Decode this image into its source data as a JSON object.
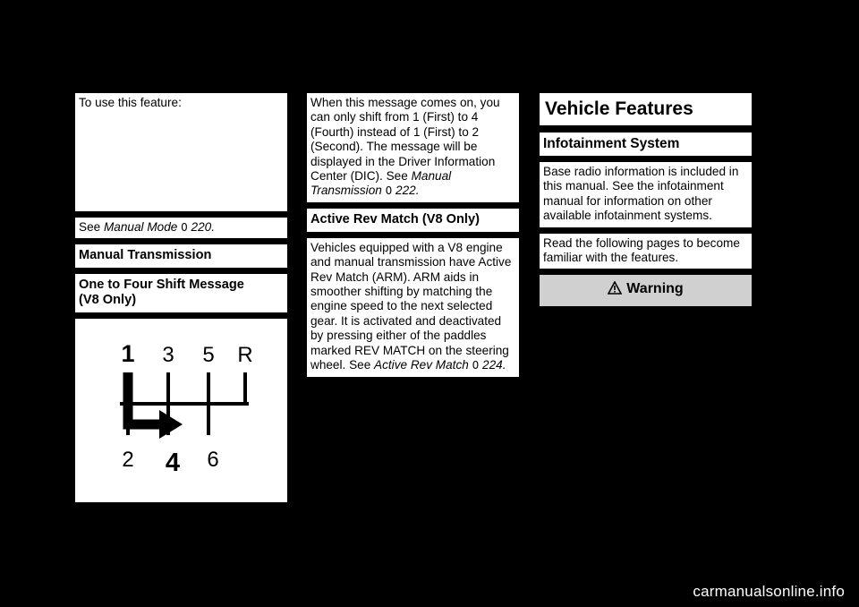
{
  "page": {
    "background_color": "#000000",
    "text_block_color": "#ffffff",
    "gray_box_color": "#d0d0d0"
  },
  "column1": {
    "intro_text": "To use this feature:",
    "see_manual_mode": {
      "lead": "See ",
      "italic": "Manual Mode",
      "marker": "0",
      "page": " 220."
    },
    "heading_manual_transmission": "Manual Transmission",
    "heading_one_to_four": "One to Four Shift Message\n(V8 Only)",
    "shift_pattern": {
      "name": "six-speed-shift-pattern-diagram",
      "top_gears": [
        "1",
        "3",
        "5",
        "R"
      ],
      "bottom_gears": [
        "2",
        "4",
        "6"
      ]
    }
  },
  "column2": {
    "para1": "When this message comes on, you can only shift from 1 (First) to 4 (Fourth) instead of 1 (First) to 2 (Second). The message will be displayed in the Driver Information Center (DIC). See ",
    "para1_italic": "Manual Transmission",
    "para1_marker": "0",
    "para1_page": " 222.",
    "heading_active_rev_match": "Active Rev Match (V8 Only)",
    "para2": "Vehicles equipped with a V8 engine and manual transmission have Active Rev Match (ARM). ARM aids in smoother shifting by matching the engine speed to the next selected gear. It is activated and deactivated by pressing either of the paddles marked REV MATCH on the steering wheel. See ",
    "para2_italic": "Active Rev Match",
    "para2_marker": "0",
    "para2_page": " 224."
  },
  "column3": {
    "chapter_title": "Vehicle Features",
    "section_title": "Infotainment System",
    "para1": "Base radio information is included in this manual. See the infotainment manual for information on other available infotainment systems.",
    "para2": "Read the following pages to become familiar with the features.",
    "warning_label": "Warning",
    "warning_icon": "warning-triangle-icon"
  },
  "footer": {
    "text": "carmanualsonline.info"
  }
}
